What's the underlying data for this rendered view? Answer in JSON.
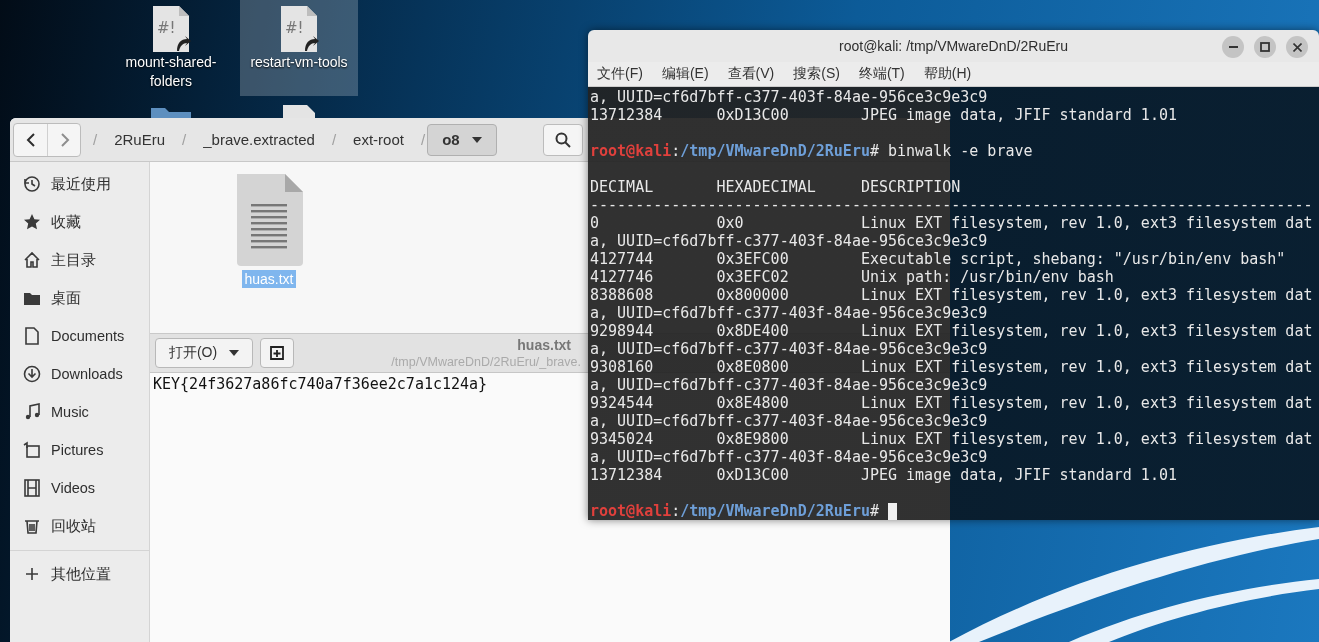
{
  "desktop": {
    "icons": [
      {
        "kind": "script",
        "glyph": "#!",
        "label": "mount-shared-folders",
        "selected": false
      },
      {
        "kind": "script",
        "glyph": "#!",
        "label": "restart-vm-tools",
        "selected": true
      },
      {
        "kind": "folder"
      },
      {
        "kind": "file"
      }
    ]
  },
  "files": {
    "nav": [
      {
        "disabled": false
      },
      {
        "disabled": true
      }
    ],
    "breadcrumb": {
      "separator": "/",
      "segments": [
        {
          "label": "2RuEru",
          "selected": false
        },
        {
          "label": "_brave.extracted",
          "selected": false
        },
        {
          "label": "ext-root",
          "selected": false
        },
        {
          "label": "o8",
          "selected": true
        }
      ]
    },
    "sidebar": {
      "items": [
        {
          "label": "最近使用",
          "selected": false
        },
        {
          "label": "收藏",
          "selected": false
        },
        {
          "label": "主目录",
          "selected": false
        },
        {
          "label": "桌面",
          "selected": false
        },
        {
          "label": "Documents",
          "selected": false
        },
        {
          "label": "Downloads",
          "selected": false
        },
        {
          "label": "Music",
          "selected": false
        },
        {
          "label": "Pictures",
          "selected": false
        },
        {
          "label": "Videos",
          "selected": false
        },
        {
          "label": "回收站",
          "selected": false
        }
      ],
      "other_locations": {
        "label": "其他位置",
        "selected": false
      }
    },
    "items": [
      {
        "name": "huas.txt",
        "selected": true
      }
    ]
  },
  "editor": {
    "open_button": "打开(O)",
    "title": "huas.txt",
    "subtitle": "/tmp/VMwareDnD/2RuEru/_brave.",
    "content": "KEY{24f3627a86fc740a7f36ee2c7a1c124a}"
  },
  "terminal": {
    "title": "root@kali: /tmp/VMwareDnD/2RuEru",
    "menu": [
      "文件(F)",
      "编辑(E)",
      "查看(V)",
      "搜索(S)",
      "终端(T)",
      "帮助(H)"
    ],
    "lines": [
      {
        "kind": "text",
        "text": "a, UUID=cf6d7bff-c377-403f-84ae-956ce3c9e3c9"
      },
      {
        "kind": "row",
        "cells": [
          "13712384",
          "0xD13C00",
          "JPEG image data, JFIF standard 1.01"
        ]
      },
      {
        "kind": "blank"
      },
      {
        "kind": "prompt",
        "user": "root@kali",
        "separator": ":",
        "path": "/tmp/VMwareDnD/2RuEru",
        "symbol": "#",
        "command": "binwalk -e brave",
        "cursor": false
      },
      {
        "kind": "blank"
      },
      {
        "kind": "row",
        "cells": [
          "DECIMAL",
          "HEXADECIMAL",
          "DESCRIPTION"
        ]
      },
      {
        "kind": "text",
        "text": "--------------------------------------------------------------------------------"
      },
      {
        "kind": "row",
        "cells": [
          "0",
          "0x0",
          "Linux EXT filesystem, rev 1.0, ext3 filesystem dat"
        ]
      },
      {
        "kind": "text",
        "text": "a, UUID=cf6d7bff-c377-403f-84ae-956ce3c9e3c9"
      },
      {
        "kind": "row",
        "cells": [
          "4127744",
          "0x3EFC00",
          "Executable script, shebang: \"/usr/bin/env bash\""
        ]
      },
      {
        "kind": "row",
        "cells": [
          "4127746",
          "0x3EFC02",
          "Unix path: /usr/bin/env bash"
        ]
      },
      {
        "kind": "row",
        "cells": [
          "8388608",
          "0x800000",
          "Linux EXT filesystem, rev 1.0, ext3 filesystem dat"
        ]
      },
      {
        "kind": "text",
        "text": "a, UUID=cf6d7bff-c377-403f-84ae-956ce3c9e3c9"
      },
      {
        "kind": "row",
        "cells": [
          "9298944",
          "0x8DE400",
          "Linux EXT filesystem, rev 1.0, ext3 filesystem dat"
        ]
      },
      {
        "kind": "text",
        "text": "a, UUID=cf6d7bff-c377-403f-84ae-956ce3c9e3c9"
      },
      {
        "kind": "row",
        "cells": [
          "9308160",
          "0x8E0800",
          "Linux EXT filesystem, rev 1.0, ext3 filesystem dat"
        ]
      },
      {
        "kind": "text",
        "text": "a, UUID=cf6d7bff-c377-403f-84ae-956ce3c9e3c9"
      },
      {
        "kind": "row",
        "cells": [
          "9324544",
          "0x8E4800",
          "Linux EXT filesystem, rev 1.0, ext3 filesystem dat"
        ]
      },
      {
        "kind": "text",
        "text": "a, UUID=cf6d7bff-c377-403f-84ae-956ce3c9e3c9"
      },
      {
        "kind": "row",
        "cells": [
          "9345024",
          "0x8E9800",
          "Linux EXT filesystem, rev 1.0, ext3 filesystem dat"
        ]
      },
      {
        "kind": "text",
        "text": "a, UUID=cf6d7bff-c377-403f-84ae-956ce3c9e3c9"
      },
      {
        "kind": "row",
        "cells": [
          "13712384",
          "0xD13C00",
          "JPEG image data, JFIF standard 1.01"
        ]
      },
      {
        "kind": "blank"
      },
      {
        "kind": "prompt",
        "user": "root@kali",
        "separator": ":",
        "path": "/tmp/VMwareDnD/2RuEru",
        "symbol": "#",
        "cursor": true
      }
    ]
  }
}
